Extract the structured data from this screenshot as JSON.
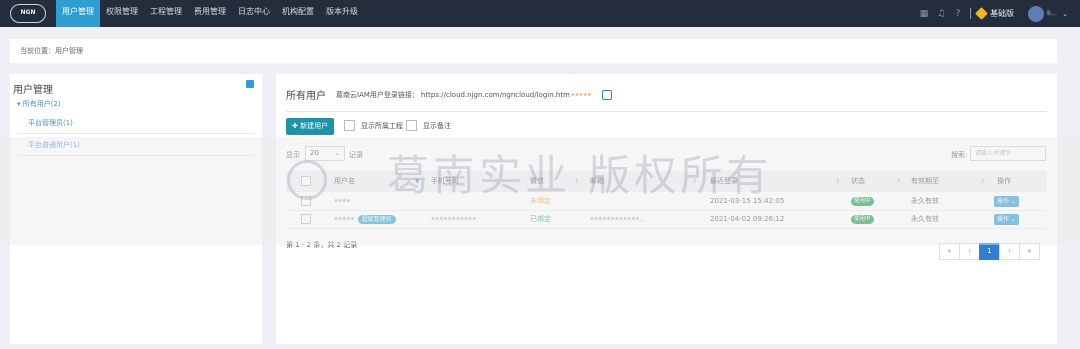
{
  "topbar": {
    "logo": "NGN",
    "nav": [
      {
        "label": "用户管理",
        "active": true
      },
      {
        "label": "权限管理",
        "active": false
      },
      {
        "label": "工程管理",
        "active": false
      },
      {
        "label": "费用管理",
        "active": false
      },
      {
        "label": "日志中心",
        "active": false
      },
      {
        "label": "机构配置",
        "active": false
      },
      {
        "label": "版本升级",
        "active": false
      }
    ],
    "tools": [
      "grid-icon",
      "bell-icon",
      "help-icon"
    ],
    "edition": "基础版",
    "user_name": "li..."
  },
  "breadcrumb": "当前位置：用户管理",
  "left": {
    "title": "用户管理",
    "root": "所有用户(2)",
    "children": [
      "平台管理员(1)",
      "平台普通用户(1)"
    ]
  },
  "main": {
    "title": "所有用户",
    "link_label": "葛南云IAM用户登录链接：",
    "link_url": "https://cloud.njgn.com/ngncloud/login.htm",
    "link_mask": "•••••",
    "new_user": "新建用户",
    "show_project": "显示所属工程",
    "show_note": "显示备注",
    "show_label": "显示",
    "page_size": "20",
    "record_label": "记录",
    "search_label": "搜索:",
    "search_placeholder": "请输入关键字",
    "columns": [
      "用户名",
      "手机号码",
      "微信",
      "邮箱",
      "最近登录",
      "状态",
      "有效期至",
      "操作"
    ],
    "rows": [
      {
        "name": "••••",
        "tag": "",
        "phone": "",
        "wechat": "未绑定",
        "wechat_bound": false,
        "email": "",
        "last_login": "2021-03-15 15:42:05",
        "status": "使用中",
        "valid": "永久有效",
        "op": "操作"
      },
      {
        "name": "•••••",
        "tag": "超级管理员",
        "phone": "•••••••••••",
        "wechat": "已绑定",
        "wechat_bound": true,
        "email": "••••••••••••...",
        "last_login": "2021-04-02 09:26:12",
        "status": "使用中",
        "valid": "永久有效",
        "op": "操作"
      }
    ],
    "summary": "第 1 - 2 条，共 2 记录",
    "pager": [
      "«",
      "‹",
      "1",
      "›",
      "»"
    ],
    "current_page": "1"
  },
  "watermark": "葛南实业 版权所有"
}
